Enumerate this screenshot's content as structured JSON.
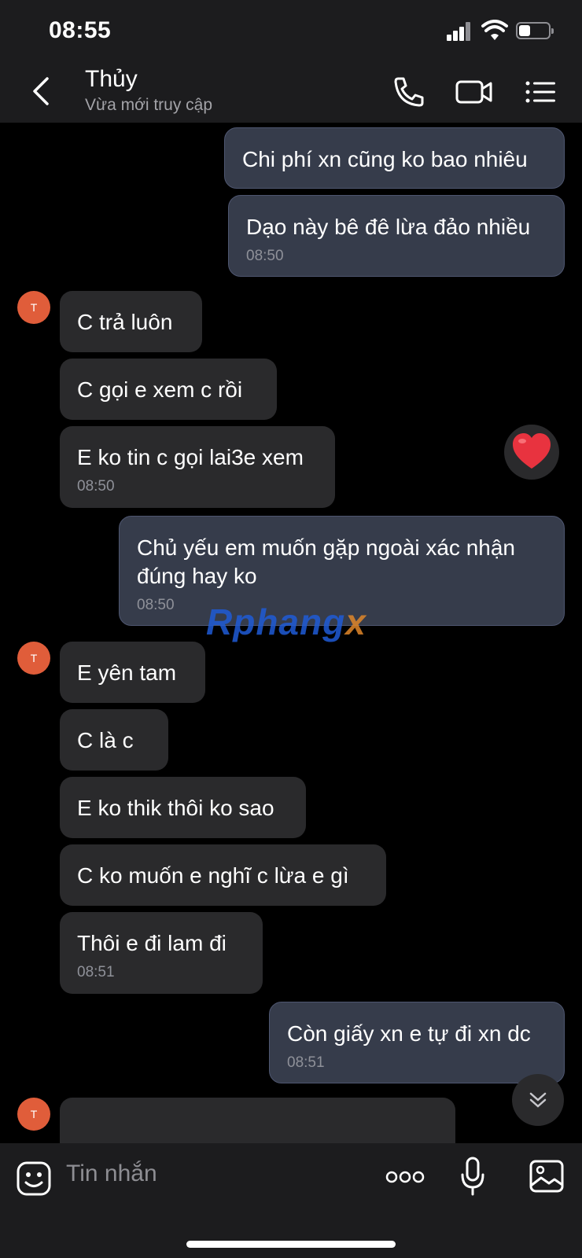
{
  "status_bar": {
    "time": "08:55"
  },
  "header": {
    "contact_name": "Thủy",
    "contact_status": "Vừa mới truy cập"
  },
  "messages": [
    {
      "dir": "out",
      "text": "Chi phí xn cũng ko bao nhiêu",
      "time": ""
    },
    {
      "dir": "out",
      "text": "Dạo này bê đê lừa đảo nhiều",
      "time": "08:50"
    },
    {
      "dir": "in",
      "text": "C trả luôn",
      "time": ""
    },
    {
      "dir": "in",
      "text": "C gọi e xem c rồi",
      "time": ""
    },
    {
      "dir": "in",
      "text": "E ko tin c gọi lai3e xem",
      "time": "08:50"
    },
    {
      "dir": "out",
      "text": "Chủ yếu em muốn gặp ngoài xác nhận đúng hay ko",
      "time": "08:50"
    },
    {
      "dir": "in",
      "text": "E yên tam",
      "time": ""
    },
    {
      "dir": "in",
      "text": "C là c",
      "time": ""
    },
    {
      "dir": "in",
      "text": "E ko thik thôi ko sao",
      "time": ""
    },
    {
      "dir": "in",
      "text": "C ko muốn e nghĩ c lừa e gì",
      "time": ""
    },
    {
      "dir": "in",
      "text": "Thôi e đi lam đi",
      "time": "08:51"
    },
    {
      "dir": "out",
      "text": "Còn giấy xn e tự đi xn dc",
      "time": "08:51"
    }
  ],
  "avatar_initial": "T",
  "reaction": "heart",
  "watermark": {
    "part1": "R",
    "part2": "phang",
    "part3": "x"
  },
  "input": {
    "placeholder": "Tin nhắn"
  },
  "icons": {
    "back": "chevron-left-icon",
    "call": "phone-icon",
    "video": "video-camera-icon",
    "menu": "list-menu-icon",
    "sticker": "sticker-face-icon",
    "more": "more-dots-icon",
    "mic": "microphone-icon",
    "image": "image-icon",
    "scroll": "scroll-down-icon"
  },
  "colors": {
    "outgoing_bubble": "#363c4b",
    "incoming_bubble": "#2a2a2c",
    "avatar": "#e05d3a",
    "reaction": "#e8333f"
  }
}
